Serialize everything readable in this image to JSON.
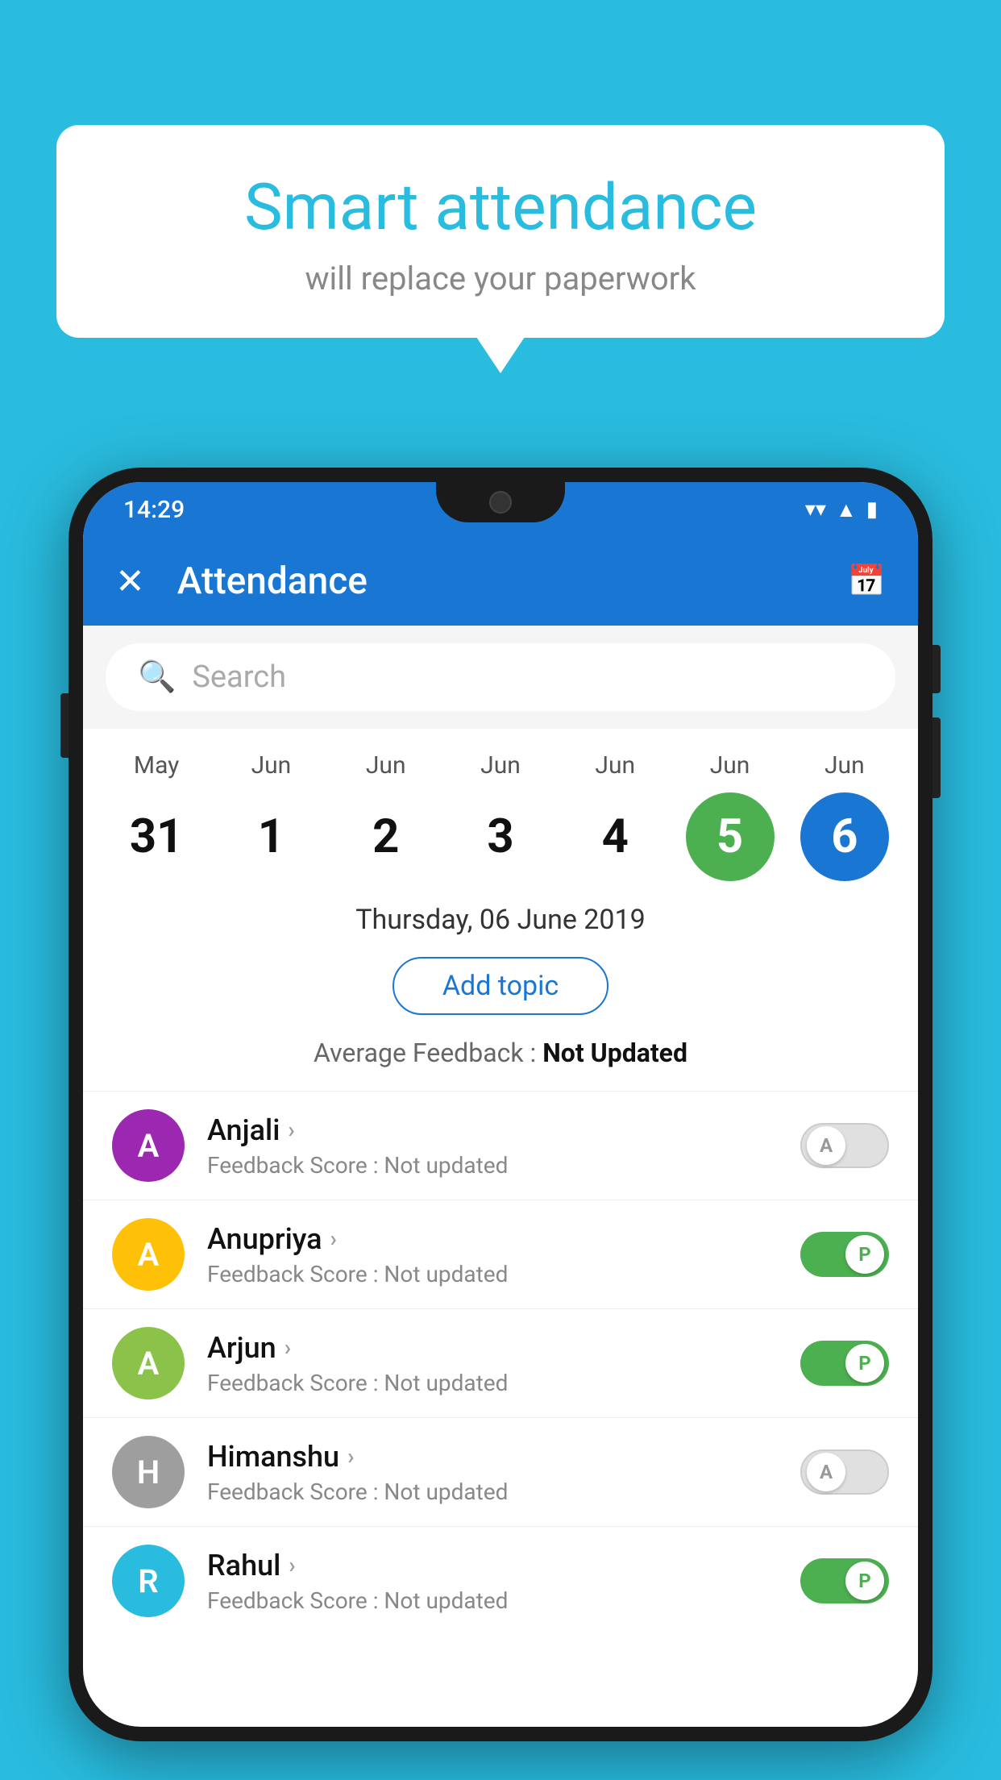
{
  "background": {
    "color": "#29BCDF"
  },
  "bubble": {
    "title": "Smart attendance",
    "subtitle": "will replace your paperwork"
  },
  "statusBar": {
    "time": "14:29",
    "wifi": "▼",
    "signal": "▲",
    "battery": "▪"
  },
  "appBar": {
    "close_label": "✕",
    "title": "Attendance",
    "calendar_icon": "📅"
  },
  "search": {
    "placeholder": "Search"
  },
  "calendar": {
    "days": [
      {
        "month": "May",
        "date": "31",
        "state": "normal"
      },
      {
        "month": "Jun",
        "date": "1",
        "state": "normal"
      },
      {
        "month": "Jun",
        "date": "2",
        "state": "normal"
      },
      {
        "month": "Jun",
        "date": "3",
        "state": "normal"
      },
      {
        "month": "Jun",
        "date": "4",
        "state": "normal"
      },
      {
        "month": "Jun",
        "date": "5",
        "state": "today"
      },
      {
        "month": "Jun",
        "date": "6",
        "state": "selected"
      }
    ]
  },
  "selectedDate": "Thursday, 06 June 2019",
  "addTopic": "Add topic",
  "averageFeedback": {
    "label": "Average Feedback : ",
    "value": "Not Updated"
  },
  "students": [
    {
      "name": "Anjali",
      "initial": "A",
      "avatarColor": "#9C27B0",
      "feedback": "Feedback Score : Not updated",
      "toggleState": "off",
      "toggleLabel": "A"
    },
    {
      "name": "Anupriya",
      "initial": "A",
      "avatarColor": "#FFC107",
      "feedback": "Feedback Score : Not updated",
      "toggleState": "on",
      "toggleLabel": "P"
    },
    {
      "name": "Arjun",
      "initial": "A",
      "avatarColor": "#8BC34A",
      "feedback": "Feedback Score : Not updated",
      "toggleState": "on",
      "toggleLabel": "P"
    },
    {
      "name": "Himanshu",
      "initial": "H",
      "avatarColor": "#9E9E9E",
      "feedback": "Feedback Score : Not updated",
      "toggleState": "off",
      "toggleLabel": "A"
    },
    {
      "name": "Rahul",
      "initial": "R",
      "avatarColor": "#29BCDF",
      "feedback": "Feedback Score : Not updated",
      "toggleState": "on",
      "toggleLabel": "P"
    }
  ]
}
